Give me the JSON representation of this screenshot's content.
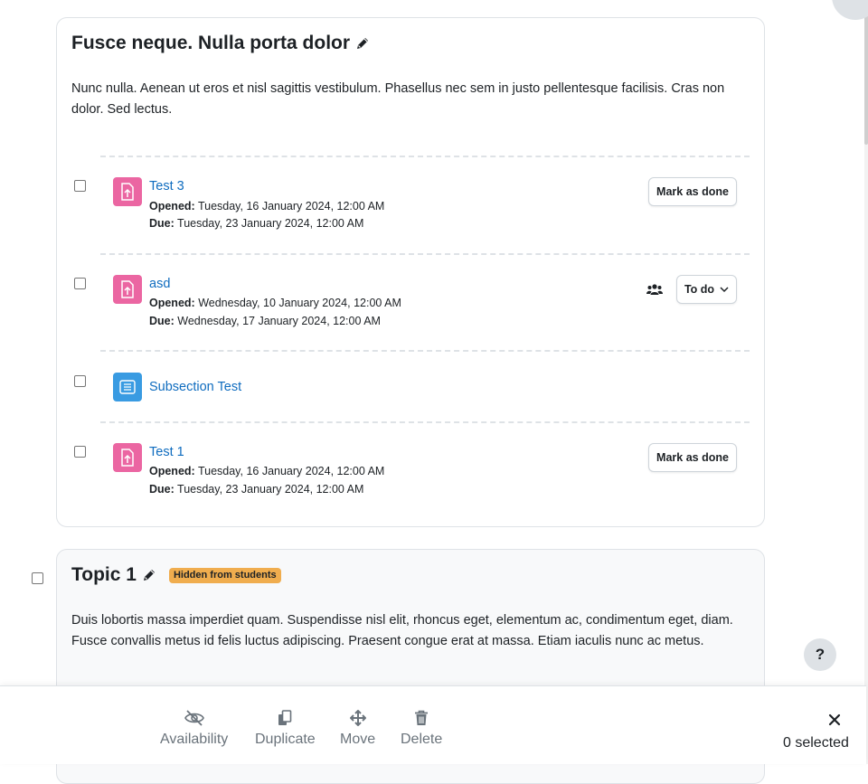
{
  "section1": {
    "title": "Fusce neque. Nulla porta dolor",
    "summary": "Nunc nulla. Aenean ut eros et nisl sagittis vestibulum. Phasellus nec sem in justo pellentesque facilisis. Cras non dolor. Sed lectus.",
    "activities": [
      {
        "name": "Test 3",
        "opened_label": "Opened:",
        "opened": "Tuesday, 16 January 2024, 12:00 AM",
        "due_label": "Due:",
        "due": "Tuesday, 23 January 2024, 12:00 AM",
        "button": "Mark as done",
        "icon": "assignment-icon"
      },
      {
        "name": "asd",
        "opened_label": "Opened:",
        "opened": "Wednesday, 10 January 2024, 12:00 AM",
        "due_label": "Due:",
        "due": "Wednesday, 17 January 2024, 12:00 AM",
        "button": "To do",
        "icon": "assignment-icon"
      },
      {
        "name": "Subsection Test",
        "icon": "subsection-icon"
      },
      {
        "name": "Test 1",
        "opened_label": "Opened:",
        "opened": "Tuesday, 16 January 2024, 12:00 AM",
        "due_label": "Due:",
        "due": "Tuesday, 23 January 2024, 12:00 AM",
        "button": "Mark as done",
        "icon": "assignment-icon"
      }
    ]
  },
  "section2": {
    "title": "Topic 1",
    "badge": "Hidden from students",
    "summary": "Duis lobortis massa imperdiet quam. Suspendisse nisl elit, rhoncus eget, elementum ac, condimentum eget, diam. Fusce convallis metus id felis luctus adipiscing. Praesent congue erat at massa. Etiam iaculis nunc ac metus."
  },
  "help": {
    "label": "?"
  },
  "footer": {
    "availability": "Availability",
    "duplicate": "Duplicate",
    "move": "Move",
    "delete": "Delete",
    "selected": "0 selected"
  },
  "colors": {
    "link": "#0f6cbf",
    "assignment_icon_bg": "#eb66a2",
    "subsection_icon_bg": "#399be2",
    "badge_bg": "#f0ad4e"
  }
}
